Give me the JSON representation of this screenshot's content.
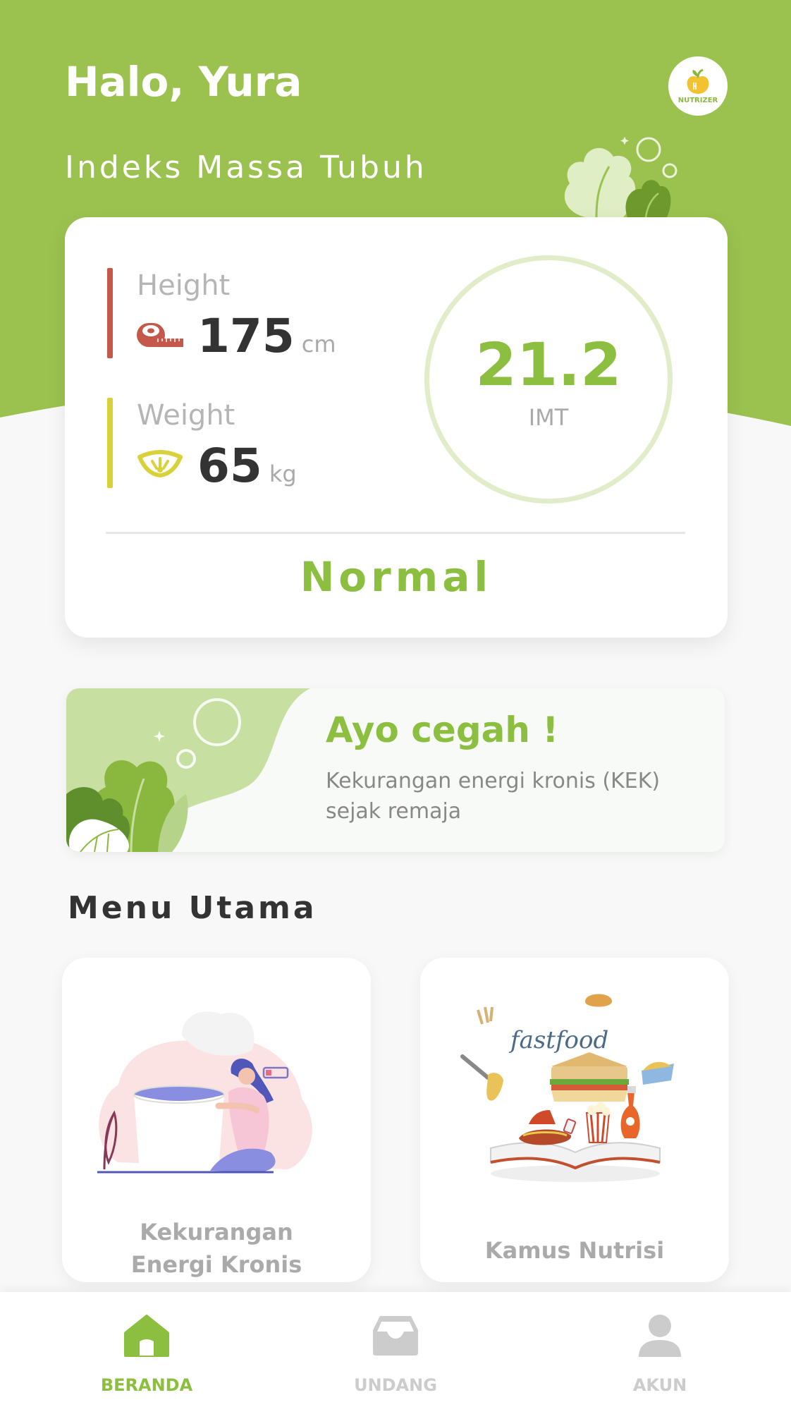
{
  "colors": {
    "brand_green": "#9bc24f",
    "accent_green": "#8cbf3f",
    "height_bar": "#c4584a",
    "weight_bar": "#d9d13a",
    "nav_inactive": "#cccccc"
  },
  "header": {
    "greeting": "Halo, Yura",
    "logo_text": "NUTRIZER",
    "section_title": "Indeks Massa Tubuh"
  },
  "bmi_card": {
    "height": {
      "label": "Height",
      "value": "175",
      "unit": "cm",
      "icon": "tape-measure-icon"
    },
    "weight": {
      "label": "Weight",
      "value": "65",
      "unit": "kg",
      "icon": "scale-icon"
    },
    "bmi": {
      "value": "21.2",
      "unit": "IMT"
    },
    "status": "Normal"
  },
  "banner": {
    "title": "Ayo cegah !",
    "subtitle": "Kekurangan energi kronis (KEK) sejak remaja"
  },
  "menu": {
    "title": "Menu Utama",
    "items": [
      {
        "label_line1": "Kekurangan",
        "label_line2": "Energi Kronis",
        "icon": "tired-woman-illustration"
      },
      {
        "label": "Kamus Nutrisi",
        "icon": "fastfood-illustration",
        "illustration_text": "fastfood"
      }
    ]
  },
  "nav": {
    "items": [
      {
        "label": "BERANDA",
        "icon": "home-icon",
        "active": true
      },
      {
        "label": "UNDANG",
        "icon": "inbox-icon",
        "active": false
      },
      {
        "label": "AKUN",
        "icon": "user-icon",
        "active": false
      }
    ]
  }
}
